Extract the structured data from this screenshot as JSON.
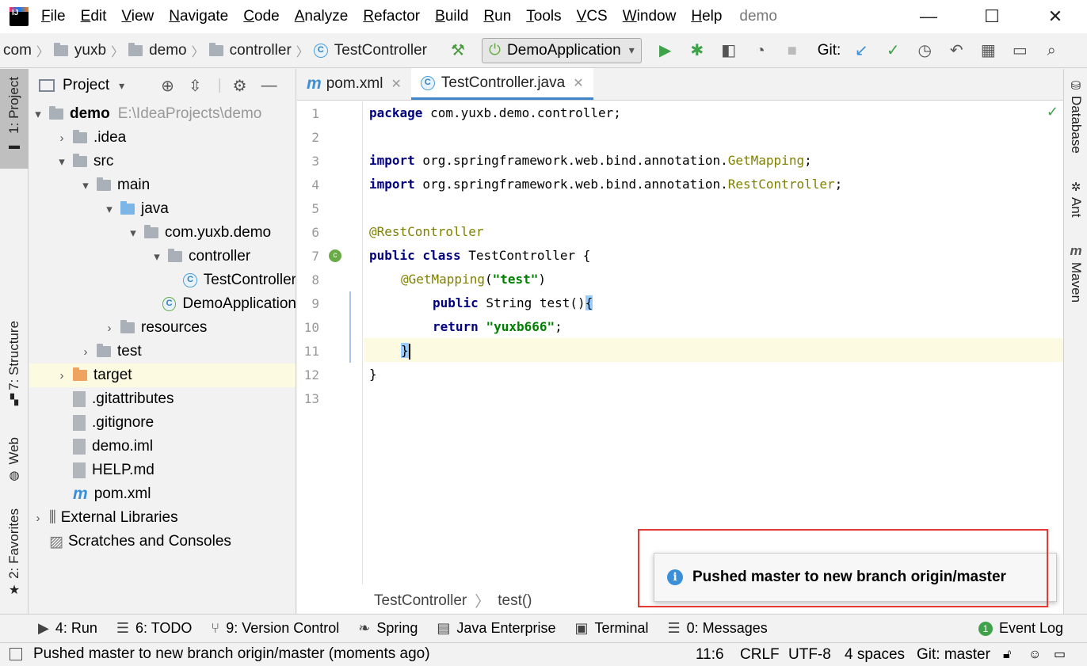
{
  "menubar": {
    "items": [
      "File",
      "Edit",
      "View",
      "Navigate",
      "Code",
      "Analyze",
      "Refactor",
      "Build",
      "Run",
      "Tools",
      "VCS",
      "Window",
      "Help"
    ],
    "title": "demo"
  },
  "window_controls": {
    "minimize": "—",
    "maximize": "☐",
    "close": "✕"
  },
  "navbar": {
    "breadcrumbs": [
      "com",
      "yuxb",
      "demo",
      "controller",
      "TestController"
    ],
    "run_config": "DemoApplication",
    "git_label": "Git:"
  },
  "left_tabs": {
    "project": "1: Project",
    "structure": "7: Structure",
    "web": "Web",
    "favorites": "2: Favorites"
  },
  "right_tabs": {
    "database": "Database",
    "ant": "Ant",
    "maven": "Maven"
  },
  "project_panel": {
    "title": "Project",
    "tree": [
      {
        "label": "demo",
        "hint": "E:\\IdeaProjects\\demo",
        "arrow": "▾",
        "icon": "module-folder-icon",
        "depth": 0
      },
      {
        "label": ".idea",
        "arrow": "›",
        "icon": "folder-icon",
        "depth": 1
      },
      {
        "label": "src",
        "arrow": "▾",
        "icon": "folder-icon",
        "depth": 1
      },
      {
        "label": "main",
        "arrow": "▾",
        "icon": "folder-icon",
        "depth": 2
      },
      {
        "label": "java",
        "arrow": "▾",
        "icon": "source-folder-icon",
        "depth": 3
      },
      {
        "label": "com.yuxb.demo",
        "arrow": "▾",
        "icon": "package-icon",
        "depth": 4
      },
      {
        "label": "controller",
        "arrow": "▾",
        "icon": "package-icon",
        "depth": 5
      },
      {
        "label": "TestController",
        "arrow": "",
        "icon": "class-icon",
        "depth": 6
      },
      {
        "label": "DemoApplication",
        "arrow": "",
        "icon": "spring-class-icon",
        "depth": 5
      },
      {
        "label": "resources",
        "arrow": "›",
        "icon": "resources-folder-icon",
        "depth": 3
      },
      {
        "label": "test",
        "arrow": "›",
        "icon": "folder-icon",
        "depth": 2
      },
      {
        "label": "target",
        "arrow": "›",
        "icon": "excluded-folder-icon",
        "depth": 1
      },
      {
        "label": ".gitattributes",
        "arrow": "",
        "icon": "file-icon",
        "depth": 1
      },
      {
        "label": ".gitignore",
        "arrow": "",
        "icon": "file-icon",
        "depth": 1
      },
      {
        "label": "demo.iml",
        "arrow": "",
        "icon": "iml-file-icon",
        "depth": 1
      },
      {
        "label": "HELP.md",
        "arrow": "",
        "icon": "markdown-file-icon",
        "depth": 1
      },
      {
        "label": "pom.xml",
        "arrow": "",
        "icon": "maven-file-icon",
        "depth": 1
      },
      {
        "label": "External Libraries",
        "arrow": "›",
        "icon": "libraries-icon",
        "depth": 0
      },
      {
        "label": "Scratches and Consoles",
        "arrow": "",
        "icon": "scratches-icon",
        "depth": 0
      }
    ]
  },
  "editor": {
    "tabs": [
      {
        "label": "pom.xml",
        "icon": "maven-icon",
        "active": false
      },
      {
        "label": "TestController.java",
        "icon": "class-icon",
        "active": true
      }
    ],
    "line_numbers": [
      "1",
      "2",
      "3",
      "4",
      "5",
      "6",
      "7",
      "8",
      "9",
      "10",
      "11",
      "12",
      "13"
    ],
    "code": {
      "l1_kw": "package",
      "l1_rest": " com.yuxb.demo.controller;",
      "l3_kw": "import",
      "l3_pkg": " org.springframework.web.bind.annotation.",
      "l3_cls": "GetMapping",
      "l3_end": ";",
      "l4_kw": "import",
      "l4_pkg": " org.springframework.web.bind.annotation.",
      "l4_cls": "RestController",
      "l4_end": ";",
      "l6_ann": "@RestController",
      "l7_kw": "public class",
      "l7_rest": " TestController {",
      "l8_ann": "@GetMapping",
      "l8_open": "(",
      "l8_str": "\"test\"",
      "l8_close": ")",
      "l9_kw": "public",
      "l9_rest": " String test()",
      "l9_brace": "{",
      "l10_kw": "return",
      "l10_str": "\"yuxb666\"",
      "l10_end": ";",
      "l11_brace": "}",
      "l12": "}"
    },
    "breadcrumb": [
      "TestController",
      "test()"
    ]
  },
  "notification": {
    "text": "Pushed master to new branch origin/master"
  },
  "tool_windows": [
    "4: Run",
    "6: TODO",
    "9: Version Control",
    "Spring",
    "Java Enterprise",
    "Terminal",
    "0: Messages"
  ],
  "event_log": {
    "label": "Event Log",
    "count": "1"
  },
  "status": {
    "message": "Pushed master to new branch origin/master (moments ago)",
    "position": "11:6",
    "line_sep": "CRLF",
    "encoding": "UTF-8",
    "indent": "4 spaces",
    "branch": "Git: master"
  }
}
